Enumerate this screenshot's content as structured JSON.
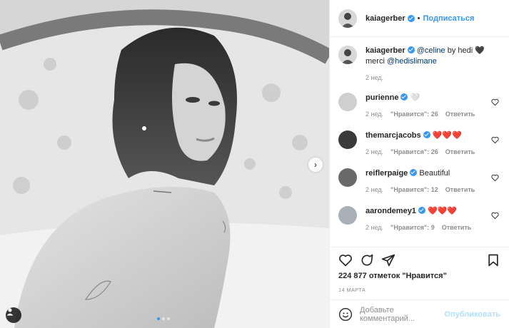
{
  "post": {
    "author": "kaiagerber",
    "separator": "•",
    "follow_label": "Подписаться",
    "caption_mention1": "@celine",
    "caption_text1": "by hedi",
    "caption_line2_prefix": "merci",
    "caption_mention2": "@hedislimane",
    "caption_age": "2 нед.",
    "likes": "224 877 отметок \"Нравится\"",
    "date": "14 марта",
    "carousel": {
      "slides": 3,
      "active": 1
    }
  },
  "comments": [
    {
      "user": "purienne",
      "text": "",
      "emoji": "🤍",
      "age": "2 нед.",
      "likes": "\"Нравится\": 26",
      "reply": "Ответить"
    },
    {
      "user": "themarcjacobs",
      "text": "",
      "emoji": "❤️❤️❤️",
      "age": "2 нед.",
      "likes": "\"Нравится\": 26",
      "reply": "Ответить"
    },
    {
      "user": "reiflerpaige",
      "text": "Beautiful",
      "emoji": "",
      "age": "2 нед.",
      "likes": "\"Нравится\": 12",
      "reply": "Ответить"
    },
    {
      "user": "aarondemey1",
      "text": "",
      "emoji": "❤️❤️❤️",
      "age": "2 нед.",
      "likes": "\"Нравится\": 9",
      "reply": "Ответить"
    }
  ],
  "composer": {
    "placeholder": "Добавьте комментарий...",
    "publish": "Опубликовать"
  },
  "colors": {
    "accent": "#3897f0",
    "text": "#262626",
    "muted": "#8e8e8e",
    "heart": "#ed4956"
  },
  "icons": [
    "heart-icon",
    "comment-icon",
    "share-icon",
    "bookmark-icon",
    "emoji-icon",
    "user-tag-icon",
    "chevron-right-icon",
    "verified-icon"
  ]
}
